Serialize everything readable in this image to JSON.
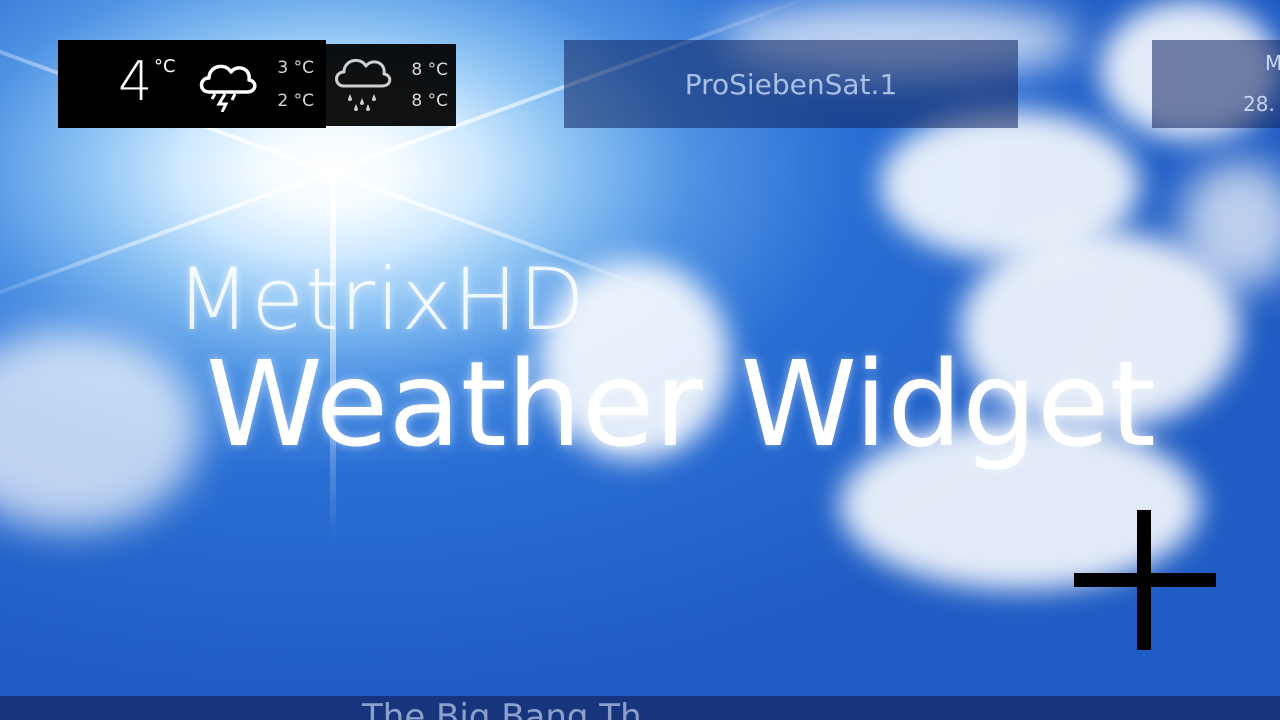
{
  "weather": {
    "current_temp": "4",
    "current_unit": "°C",
    "today": {
      "icon": "thunderstorm-cloud-icon",
      "high": "3 °C",
      "low": "2 °C"
    },
    "tomorrow": {
      "icon": "rain-cloud-icon",
      "high": "8 °C",
      "low": "8 °C"
    }
  },
  "channel": {
    "name": "ProSiebenSat.1"
  },
  "clock": {
    "line1": "M",
    "line2": "28."
  },
  "title": {
    "line1": "MetrixHD",
    "line2": "Weather Widget"
  },
  "now_playing": {
    "text": "The Big Bang Th"
  },
  "colors": {
    "accent_panel": "#000000",
    "channel_text": "#a9bfe6",
    "sky": "#1f5cc4"
  }
}
